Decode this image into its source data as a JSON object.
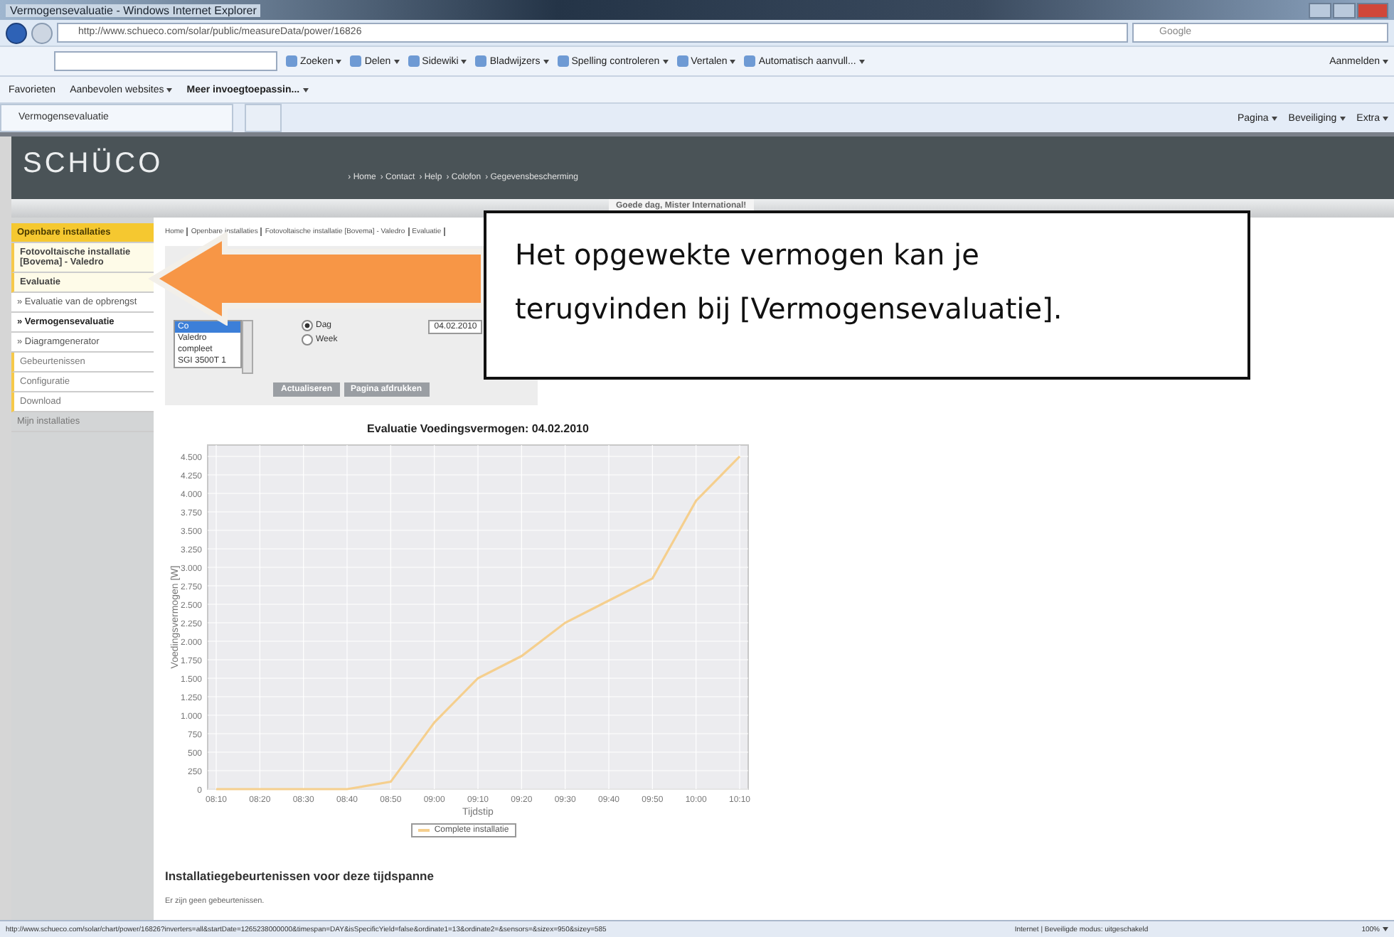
{
  "browser": {
    "title": "Vermogensevaluatie - Windows Internet Explorer",
    "address": "http://www.schueco.com/solar/public/measureData/power/16826",
    "search_hint": "Google",
    "toolbar": [
      {
        "label": "Zoeken"
      },
      {
        "label": "Delen"
      },
      {
        "label": "Sidewiki"
      },
      {
        "label": "Bladwijzers"
      },
      {
        "label": "Spelling controleren"
      },
      {
        "label": "Vertalen"
      },
      {
        "label": "Automatisch aanvull..."
      }
    ],
    "toolbar_right": "Aanmelden",
    "favorites": [
      {
        "label": "Favorieten"
      },
      {
        "label": "Aanbevolen websites"
      },
      {
        "label": "Meer invoegtoepassin..."
      }
    ],
    "tab": "Vermogensevaluatie",
    "commands": [
      "Pagina",
      "Beveiliging",
      "Extra"
    ],
    "status_url": "http://www.schueco.com/solar/chart/power/16826?inverters=all&startDate=1265238000000&timespan=DAY&isSpecificYield=false&ordinate1=13&ordinate2=&sensors=&sizex=950&sizey=585",
    "status_zone": "Internet | Beveiligde modus: uitgeschakeld",
    "zoom": "100%"
  },
  "site": {
    "logo": "SCHÜCO",
    "nav_links": [
      "› Home",
      "› Contact",
      "› Help",
      "› Colofon",
      "› Gegevensbescherming"
    ],
    "greeting": "Goede dag, Mister International!",
    "sidebar": [
      {
        "kind": "header",
        "label": "Openbare installaties",
        "selected": false
      },
      {
        "kind": "group",
        "label": "Fotovoltaische installatie [Bovema] - Valedro",
        "selected": false
      },
      {
        "kind": "group",
        "label": "Evaluatie",
        "selected": false
      },
      {
        "kind": "sub",
        "label": "» Evaluatie van de opbrengst",
        "selected": false
      },
      {
        "kind": "sub",
        "label": "» Vermogensevaluatie",
        "selected": true
      },
      {
        "kind": "sub",
        "label": "» Diagramgenerator",
        "selected": false
      },
      {
        "kind": "item",
        "label": "Gebeurtenissen",
        "selected": false
      },
      {
        "kind": "item",
        "label": "Configuratie",
        "selected": false
      },
      {
        "kind": "item",
        "label": "Download",
        "selected": false
      },
      {
        "kind": "footer",
        "label": "Mijn installaties",
        "selected": false
      }
    ],
    "breadcrumb": [
      "Home",
      "Openbare installaties",
      "Fotovoltaische installatie [Bovema] - Valedro",
      "Evaluatie"
    ],
    "listbox": [
      {
        "label": "Co",
        "selected": true
      },
      {
        "label": "Valedro",
        "selected": false
      },
      {
        "label": "compleet",
        "selected": false
      },
      {
        "label": "SGI 3500T 1",
        "selected": false
      }
    ],
    "radios": [
      {
        "label": "Dag",
        "selected": true
      },
      {
        "label": "Week",
        "selected": false
      }
    ],
    "date": "04.02.2010",
    "buttons": [
      "Actualiseren",
      "Pagina afdrukken"
    ],
    "chart_data": {
      "type": "line",
      "title": "Evaluatie  Voedingsvermogen: 04.02.2010",
      "xlabel": "Tijdstip",
      "ylabel": "Voedingsvermogen [W]",
      "categories": [
        "08:10",
        "08:20",
        "08:30",
        "08:40",
        "08:50",
        "09:00",
        "09:10",
        "09:20",
        "09:30",
        "09:40",
        "09:50",
        "10:00",
        "10:10"
      ],
      "series": [
        {
          "name": "Complete installatie",
          "color": "#f5cf8e",
          "values": [
            0,
            0,
            0,
            0,
            100,
            900,
            1500,
            1800,
            2250,
            2550,
            2850,
            3900,
            4500
          ]
        }
      ],
      "ylim": [
        0,
        4500
      ],
      "grid": true,
      "yticks": [
        {
          "value": 0,
          "label": "0"
        },
        {
          "value": 250,
          "label": "250"
        },
        {
          "value": 500,
          "label": "500"
        },
        {
          "value": 750,
          "label": "750"
        },
        {
          "value": 1000,
          "label": "1.000"
        },
        {
          "value": 1250,
          "label": "1.250"
        },
        {
          "value": 1500,
          "label": "1.500"
        },
        {
          "value": 1750,
          "label": "1.750"
        },
        {
          "value": 2000,
          "label": "2.000"
        },
        {
          "value": 2250,
          "label": "2.250"
        },
        {
          "value": 2500,
          "label": "2.500"
        },
        {
          "value": 2750,
          "label": "2.750"
        },
        {
          "value": 3000,
          "label": "3.000"
        },
        {
          "value": 3250,
          "label": "3.250"
        },
        {
          "value": 3500,
          "label": "3.500"
        },
        {
          "value": 3750,
          "label": "3.750"
        },
        {
          "value": 4000,
          "label": "4.000"
        },
        {
          "value": 4250,
          "label": "4.250"
        },
        {
          "value": 4500,
          "label": "4.500"
        }
      ]
    },
    "events_title": "Installatiegebeurtenissen voor deze tijdspanne",
    "events_text": "Er zijn geen gebeurtenissen."
  },
  "callout": "Het opgewekte vermogen kan je terugvinden bij [Vermogensevaluatie]."
}
